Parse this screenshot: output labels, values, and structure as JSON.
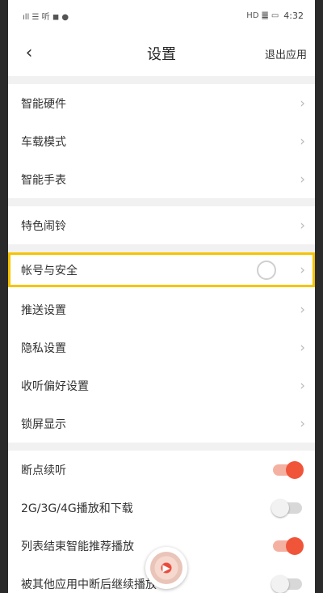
{
  "statusbar": {
    "left_icons": "ıll ☰ 听 ◼ ●",
    "right_icons": "HD ䷀ ▭",
    "time": "4:32"
  },
  "navbar": {
    "back_icon": "‹",
    "title": "设置",
    "exit_label": "退出应用"
  },
  "groups": [
    {
      "items": [
        {
          "label": "智能硬件"
        },
        {
          "label": "车载模式"
        },
        {
          "label": "智能手表"
        }
      ]
    },
    {
      "items": [
        {
          "label": "特色闹铃"
        }
      ]
    },
    {
      "items": [
        {
          "label": "帐号与安全"
        },
        {
          "label": "推送设置"
        },
        {
          "label": "隐私设置"
        },
        {
          "label": "收听偏好设置"
        },
        {
          "label": "锁屏显示"
        }
      ]
    },
    {
      "toggles": [
        {
          "label": "断点续听",
          "on": true
        },
        {
          "label": "2G/3G/4G播放和下载",
          "on": false
        },
        {
          "label": "列表结束智能推荐播放",
          "on": true
        },
        {
          "label": "被其他应用中断后继续播放",
          "on": false
        }
      ]
    }
  ],
  "chevron_glyph": "›",
  "colors": {
    "accent": "#f0553a",
    "highlight": "#f5c400"
  }
}
